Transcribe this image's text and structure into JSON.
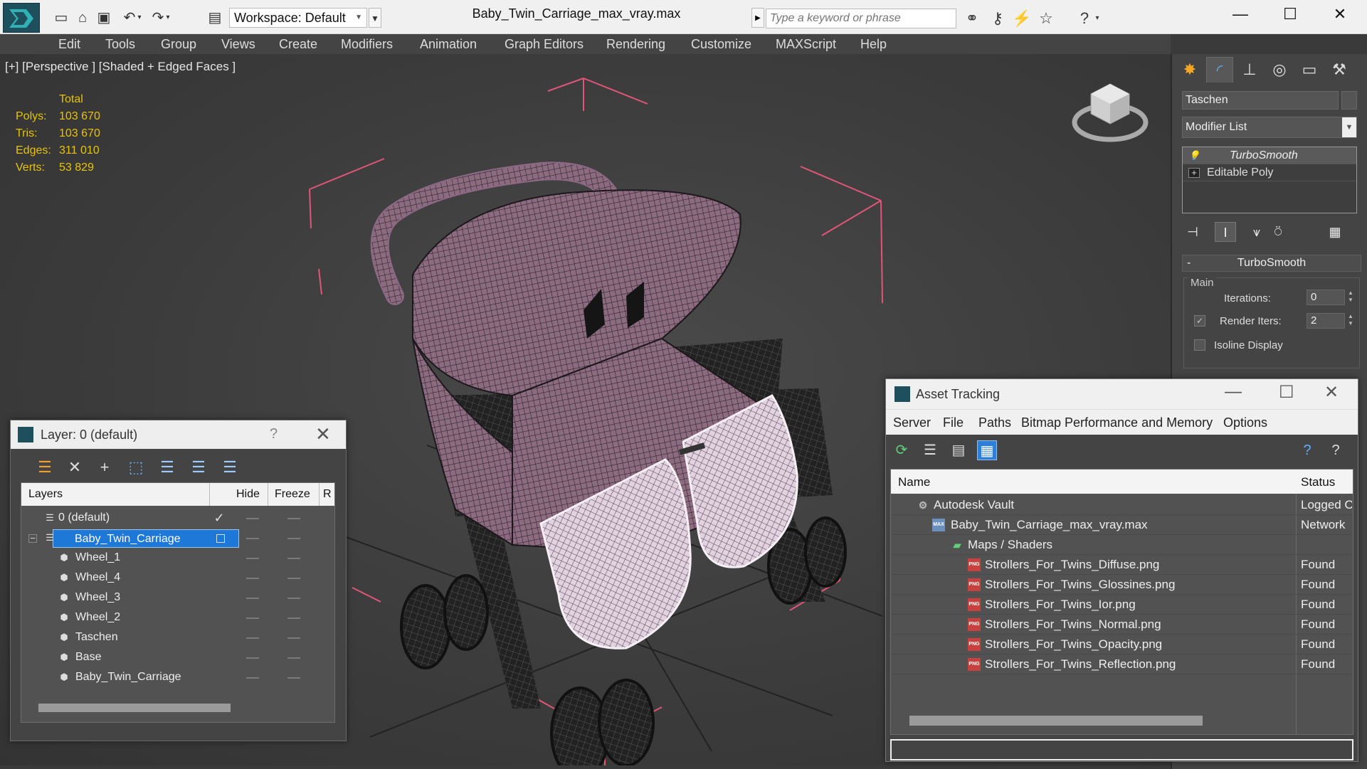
{
  "titlebar": {
    "workspace": "Workspace: Default",
    "document_title": "Baby_Twin_Carriage_max_vray.max",
    "search_placeholder": "Type a keyword or phrase",
    "minimize": "—",
    "maximize": "☐",
    "close": "✕"
  },
  "menu": [
    "Edit",
    "Tools",
    "Group",
    "Views",
    "Create",
    "Modifiers",
    "Animation",
    "Graph Editors",
    "Rendering",
    "Customize",
    "MAXScript",
    "Help"
  ],
  "viewport": {
    "label": "[+] [Perspective ] [Shaded + Edged Faces ]",
    "stats": {
      "header": "Total",
      "rows": [
        {
          "label": "Polys:",
          "value": "103 670"
        },
        {
          "label": "Tris:",
          "value": "103 670"
        },
        {
          "label": "Edges:",
          "value": "311 010"
        },
        {
          "label": "Verts:",
          "value": "53 829"
        }
      ]
    }
  },
  "command_panel": {
    "object_name": "Taschen",
    "modifier_list": "Modifier List",
    "stack": [
      {
        "label": "TurboSmooth",
        "icon": "lightbulb-icon",
        "selected": true
      },
      {
        "label": "Editable Poly",
        "icon": "plus-box-icon",
        "selected": false
      }
    ],
    "rollout": {
      "title": "TurboSmooth",
      "collapse": "-",
      "group": "Main",
      "iterations_label": "Iterations:",
      "iterations_value": "0",
      "render_iters_label": "Render Iters:",
      "render_iters_value": "2",
      "render_iters_checked": true,
      "isoline_label": "Isoline Display",
      "isoline_checked": false
    }
  },
  "layer_dialog": {
    "title": "Layer: 0 (default)",
    "help": "?",
    "close": "✕",
    "columns": [
      "Layers",
      "Hide",
      "Freeze",
      "R"
    ],
    "rows": [
      {
        "name": "0 (default)",
        "indent": 1,
        "active_check": "✓",
        "icon": "layer-stack-icon"
      },
      {
        "name": "Baby_Twin_Carriage",
        "indent": 1,
        "selected": true,
        "expander": "−",
        "icon": "layer-stack-icon"
      },
      {
        "name": "Wheel_1",
        "indent": 2,
        "icon": "object-icon"
      },
      {
        "name": "Wheel_4",
        "indent": 2,
        "icon": "object-icon"
      },
      {
        "name": "Wheel_3",
        "indent": 2,
        "icon": "object-icon"
      },
      {
        "name": "Wheel_2",
        "indent": 2,
        "icon": "object-icon"
      },
      {
        "name": "Taschen",
        "indent": 2,
        "icon": "object-icon"
      },
      {
        "name": "Base",
        "indent": 2,
        "icon": "object-icon"
      },
      {
        "name": "Baby_Twin_Carriage",
        "indent": 2,
        "icon": "object-icon"
      }
    ]
  },
  "asset_tracking": {
    "title": "Asset Tracking",
    "menu": [
      "Server",
      "File",
      "Paths",
      "Bitmap Performance and Memory",
      "Options"
    ],
    "columns": {
      "name": "Name",
      "status": "Status"
    },
    "rows": [
      {
        "name": "Autodesk Vault",
        "status": "Logged Out",
        "level": 1,
        "icon": "vault-icon",
        "icon_text": "⚙"
      },
      {
        "name": "Baby_Twin_Carriage_max_vray.max",
        "status": "Network",
        "level": 2,
        "icon": "max-file-icon",
        "icon_text": "MAX"
      },
      {
        "name": "Maps / Shaders",
        "status": "",
        "level": 3,
        "icon": "maps-icon",
        "icon_text": "▰"
      },
      {
        "name": "Strollers_For_Twins_Diffuse.png",
        "status": "Found",
        "level": 4,
        "icon": "png-icon",
        "icon_text": "PNG"
      },
      {
        "name": "Strollers_For_Twins_Glossines.png",
        "status": "Found",
        "level": 4,
        "icon": "png-icon",
        "icon_text": "PNG"
      },
      {
        "name": "Strollers_For_Twins_Ior.png",
        "status": "Found",
        "level": 4,
        "icon": "png-icon",
        "icon_text": "PNG"
      },
      {
        "name": "Strollers_For_Twins_Normal.png",
        "status": "Found",
        "level": 4,
        "icon": "png-icon",
        "icon_text": "PNG"
      },
      {
        "name": "Strollers_For_Twins_Opacity.png",
        "status": "Found",
        "level": 4,
        "icon": "png-icon",
        "icon_text": "PNG"
      },
      {
        "name": "Strollers_For_Twins_Reflection.png",
        "status": "Found",
        "level": 4,
        "icon": "png-icon",
        "icon_text": "PNG"
      }
    ]
  },
  "colors": {
    "stats_yellow": "#e8c400",
    "selection_blue": "#1e78d7",
    "bbox_pink": "#e0557a",
    "wire_pink": "#d4a5c0",
    "wire_white": "#f2eef2"
  }
}
